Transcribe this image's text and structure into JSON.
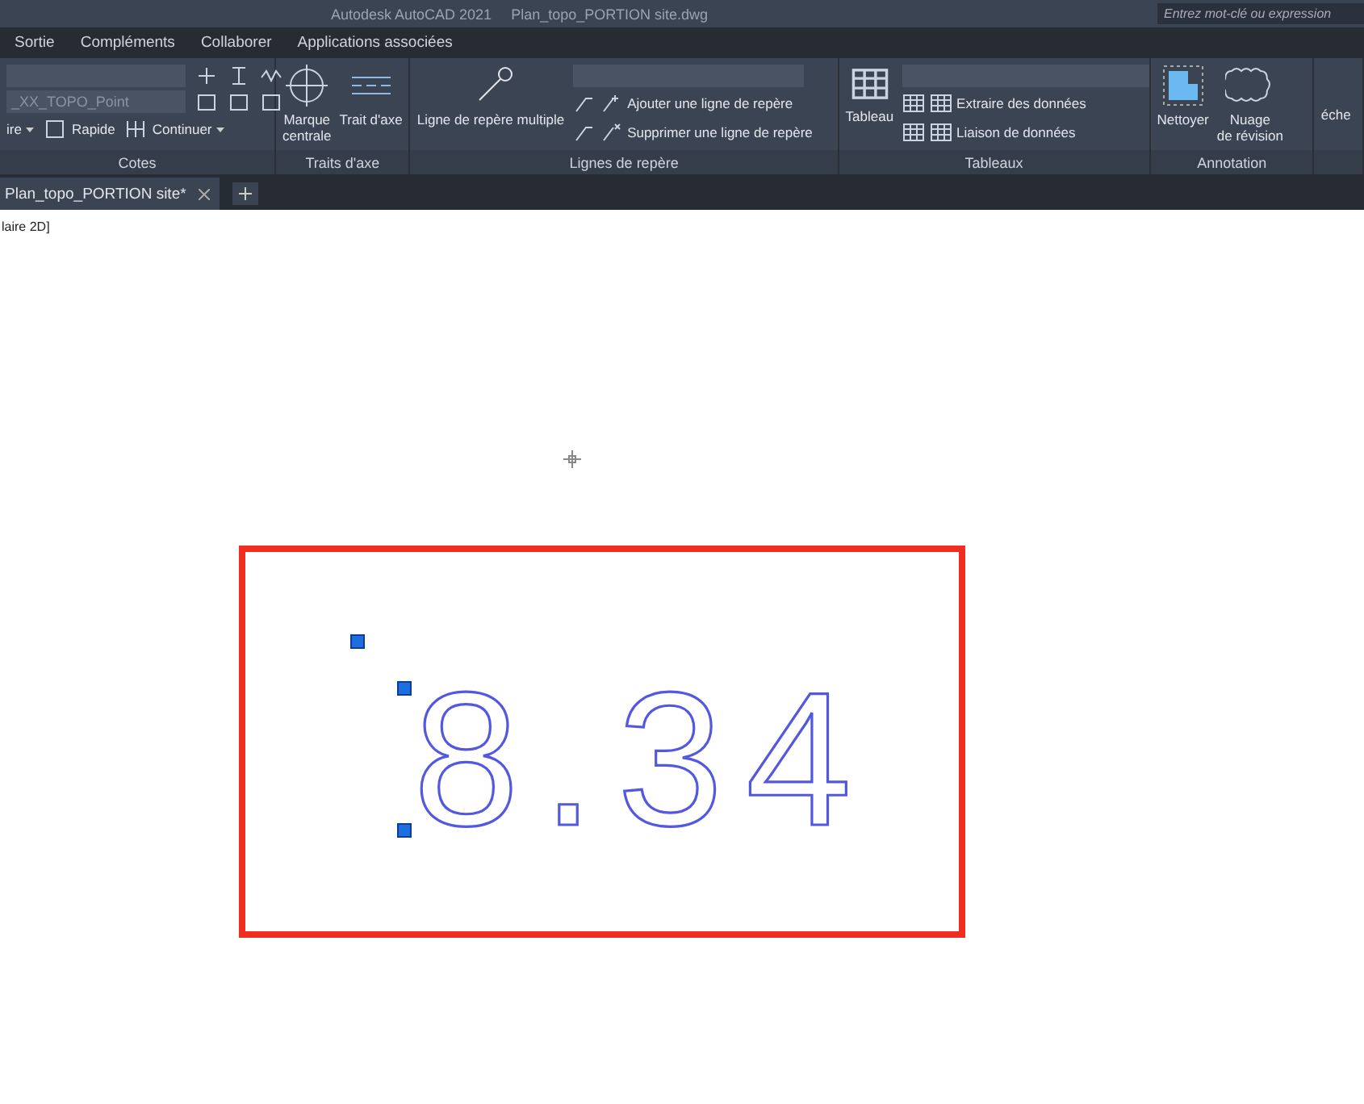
{
  "title_bar": {
    "app": "Autodesk AutoCAD 2021",
    "file": "Plan_topo_PORTION site.dwg",
    "search": {
      "placeholder": "Entrez mot-clé ou expression"
    }
  },
  "menu": [
    {
      "label": "Sortie"
    },
    {
      "label": "Compléments"
    },
    {
      "label": "Collaborer"
    },
    {
      "label": "Applications associées"
    }
  ],
  "ribbon": {
    "panels": [
      {
        "kind": "cotes",
        "title": "Cotes",
        "style_value": "_XX_TOPO_Point",
        "buttons": [
          "ire",
          "Rapide",
          "Continuer"
        ]
      },
      {
        "kind": "large",
        "title": "Traits d'axe",
        "buttons": [
          "Marque\ncentrale",
          "Trait d'axe"
        ]
      },
      {
        "kind": "leaders",
        "title": "Lignes de repère",
        "buttons": [
          "Ligne de repère multiple",
          "Ajouter une ligne de repère",
          "Supprimer une ligne de repère"
        ]
      },
      {
        "kind": "tables",
        "title": "Tableaux",
        "buttons": [
          "Tableau",
          "Extraire des données",
          "Liaison de données"
        ]
      },
      {
        "kind": "annotation",
        "title": "Annotation",
        "buttons": [
          "Nettoyer",
          "Nuage\nde révision"
        ]
      },
      {
        "kind": "cut",
        "buttons": [
          "éche"
        ]
      }
    ]
  },
  "tabs": [
    {
      "label": "Plan_topo_PORTION site*",
      "selected": true
    }
  ],
  "viewport": {
    "label": "laire 2D]",
    "text": "8.34",
    "highlighted": true
  }
}
